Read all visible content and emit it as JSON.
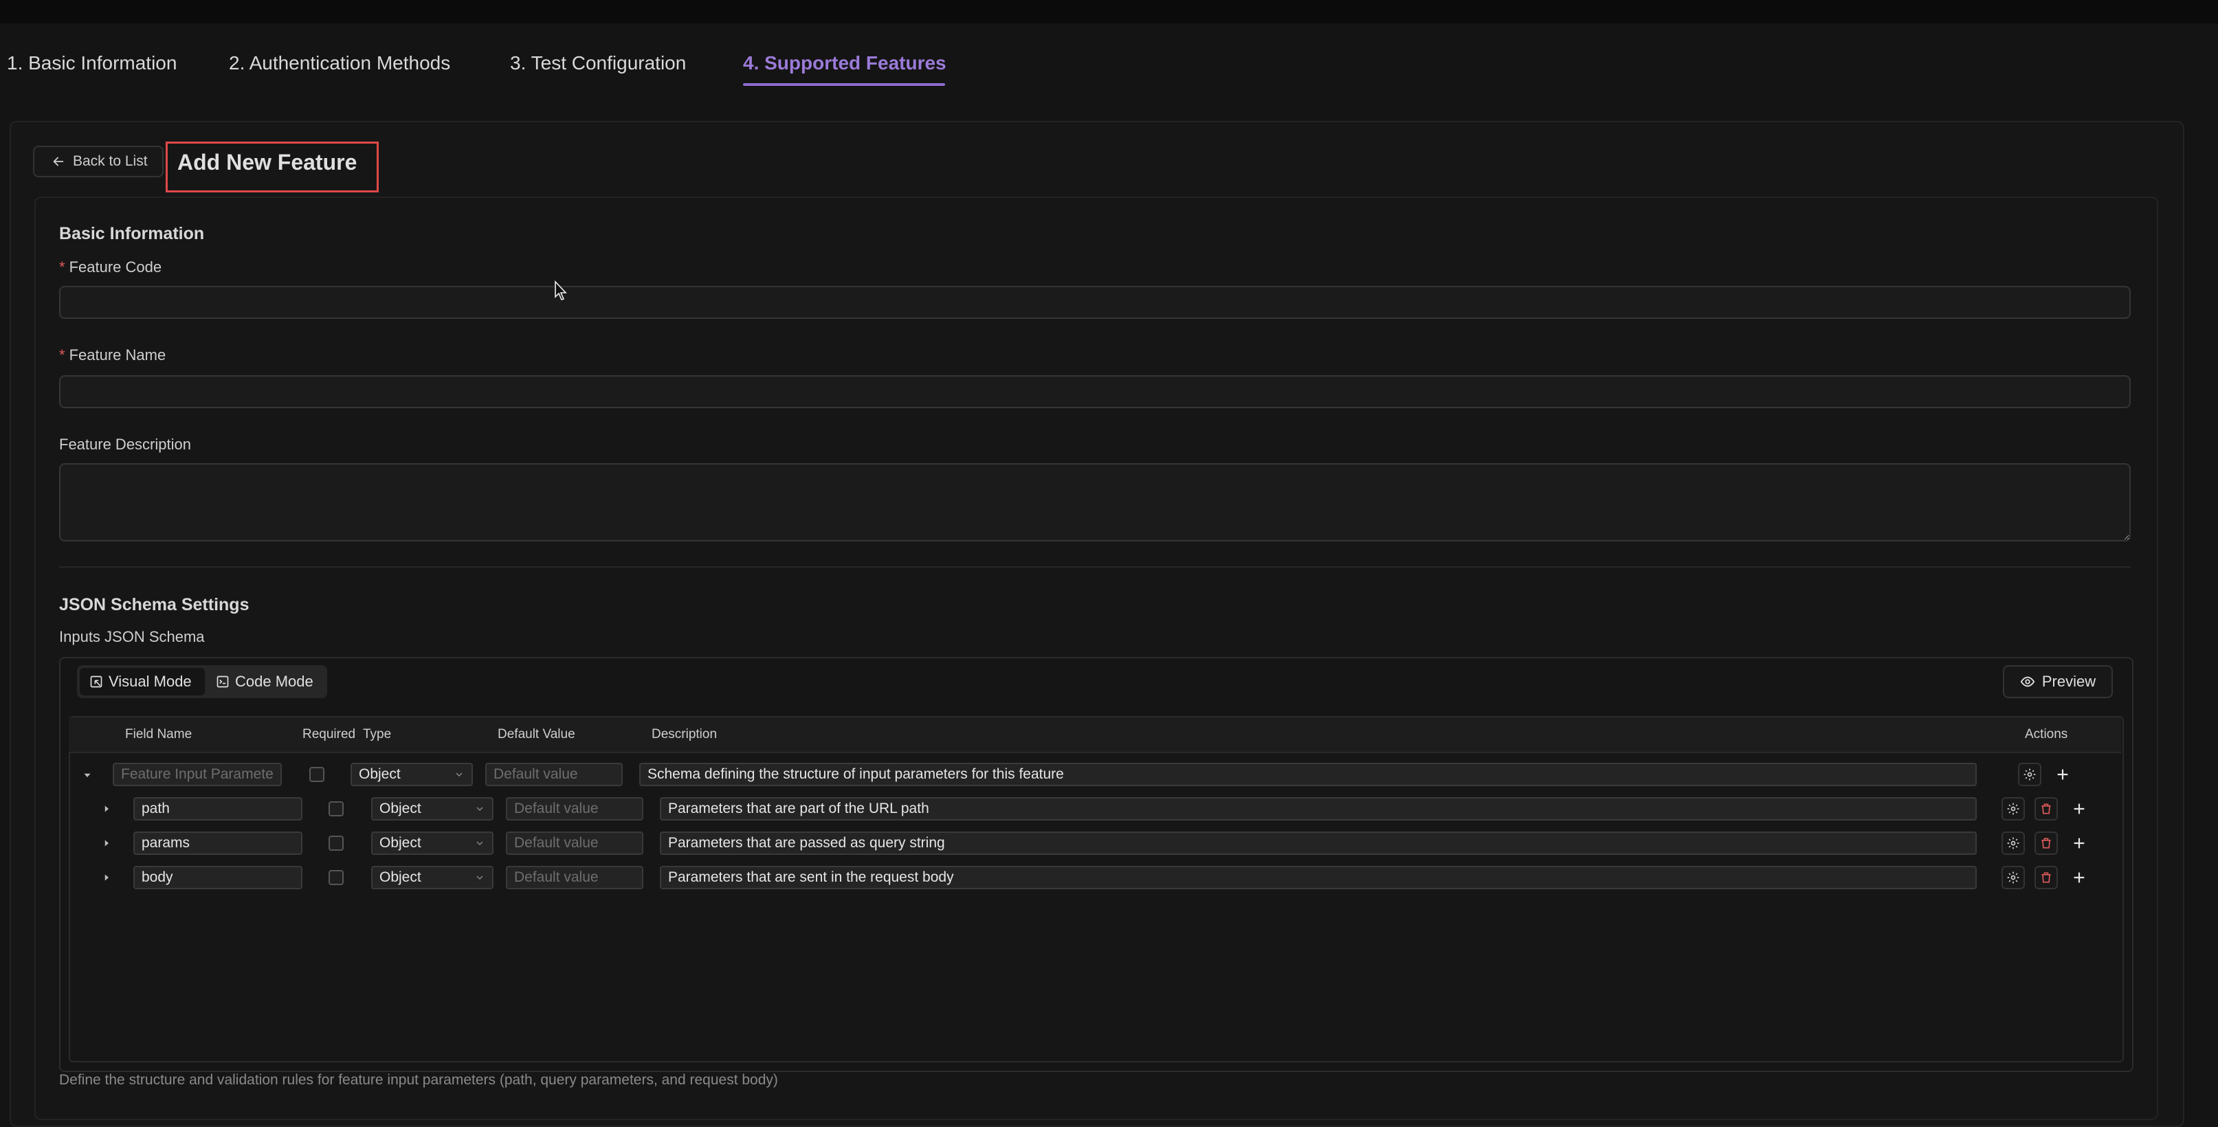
{
  "steps": [
    {
      "label": "1. Basic Information"
    },
    {
      "label": "2. Authentication Methods"
    },
    {
      "label": "3. Test Configuration"
    },
    {
      "label": "4. Supported Features",
      "active": true
    }
  ],
  "header": {
    "back_label": "Back to List",
    "title": "Add New Feature"
  },
  "basic": {
    "section_title": "Basic Information",
    "feature_code_label": "Feature Code",
    "feature_name_label": "Feature Name",
    "feature_description_label": "Feature Description",
    "required_marker": "*",
    "feature_code_value": "",
    "feature_name_value": "",
    "feature_description_value": ""
  },
  "schema": {
    "section_title": "JSON Schema Settings",
    "inputs_label": "Inputs JSON Schema",
    "visual_mode_label": "Visual Mode",
    "code_mode_label": "Code Mode",
    "preview_label": "Preview",
    "columns": {
      "field_name": "Field Name",
      "required": "Required",
      "type": "Type",
      "default_value": "Default Value",
      "description": "Description",
      "actions": "Actions"
    },
    "root": {
      "name_placeholder": "Feature Input Parameters",
      "type": "Object",
      "default_placeholder": "Default value",
      "description": "Schema defining the structure of input parameters for this feature"
    },
    "rows": [
      {
        "name": "path",
        "type": "Object",
        "default_placeholder": "Default value",
        "description": "Parameters that are part of the URL path"
      },
      {
        "name": "params",
        "type": "Object",
        "default_placeholder": "Default value",
        "description": "Parameters that are passed as query string"
      },
      {
        "name": "body",
        "type": "Object",
        "default_placeholder": "Default value",
        "description": "Parameters that are sent in the request body"
      }
    ],
    "help_text": "Define the structure and validation rules for feature input parameters (path, query parameters, and request body)"
  },
  "colors": {
    "accent": "#9b7bd8",
    "danger": "#e05a5a",
    "background": "#141414"
  }
}
